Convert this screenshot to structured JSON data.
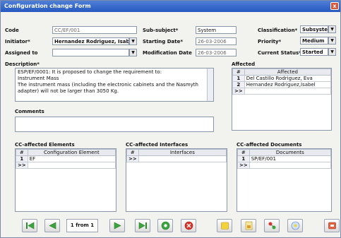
{
  "window": {
    "title": "Configuration change Form",
    "close": "x"
  },
  "row1": {
    "code_label": "Code",
    "code_value": "CC/EF/001",
    "subsubject_label": "Sub-subject*",
    "subsubject_value": "System",
    "classification_label": "Classification*",
    "classification_value": "Subsyste..."
  },
  "row2": {
    "initiator_label": "Initiator*",
    "initiator_value": "Hernandez Rodriguez, Isabel",
    "starting_label": "Starting Date*",
    "starting_value": "26-03-2006",
    "priority_label": "Priority*",
    "priority_value": "Medium"
  },
  "row3": {
    "assigned_label": "Assigned to",
    "assigned_value": "",
    "modification_label": "Modification Date",
    "modification_value": "26-03-2006",
    "status_label": "Current Status*",
    "status_value": "Started"
  },
  "description": {
    "label": "Description*",
    "lines": [
      "ESP/EF/0001: It is proposed to change the requirement to:",
      "Instrument Mass",
      "The instrument mass (including the electronic cabinets and the Nasmyth",
      "adapter) will not be larger than 3050 Kg."
    ]
  },
  "affected": {
    "label": "Affected",
    "col_num": "#",
    "col_name": "Affected",
    "rows": [
      {
        "num": "1",
        "name": "Del Castillo Rodriguez, Eva"
      },
      {
        "num": "2",
        "name": "Hernandez Rodriguez,Isabel"
      },
      {
        "num": ">>",
        "name": ""
      }
    ]
  },
  "comments": {
    "label": "Comments",
    "value": ""
  },
  "cc_elements": {
    "label": "CC-affected Elements",
    "col_num": "#",
    "col_name": "Configuration Element",
    "rows": [
      {
        "num": "1",
        "name": "EF"
      },
      {
        "num": ">>",
        "name": ""
      }
    ]
  },
  "cc_interfaces": {
    "label": "CC-affected Interfaces",
    "col_num": "#",
    "col_name": "Interfaces",
    "rows": [
      {
        "num": ">>",
        "name": ""
      }
    ]
  },
  "cc_documents": {
    "label": "CC-affected Documents",
    "col_num": "#",
    "col_name": "Documents",
    "rows": [
      {
        "num": "1",
        "name": "SP/EF/001"
      },
      {
        "num": ">>",
        "name": ""
      }
    ]
  },
  "toolbar": {
    "pager_text": "1 from 1",
    "icons": [
      "first-icon",
      "previous-icon",
      "next-icon",
      "last-icon",
      "new-record-icon",
      "delete-icon",
      "folder-icon",
      "report-icon",
      "workflow-icon",
      "help-icon",
      "exit-icon"
    ]
  },
  "colors": {
    "title_bar": "#2659c0",
    "nav_green": "#3aa53a",
    "delete_red": "#d8352b"
  }
}
